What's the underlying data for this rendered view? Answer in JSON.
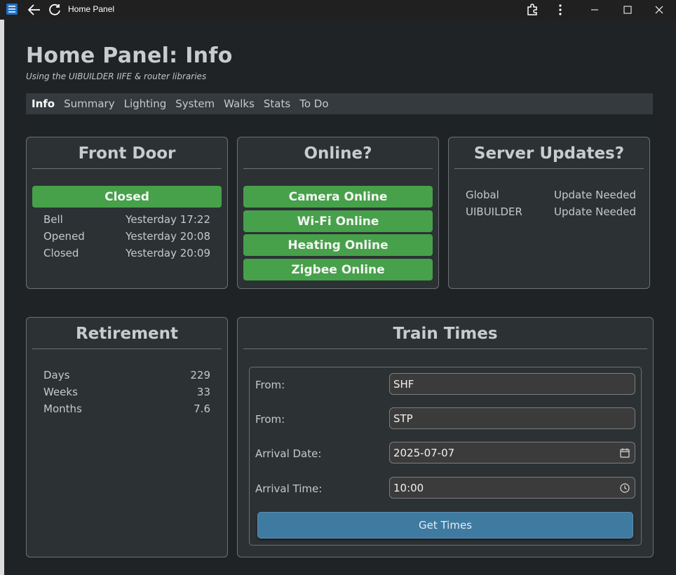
{
  "window": {
    "title": "Home Panel"
  },
  "page": {
    "title": "Home Panel: Info",
    "subtitle": "Using the UIBUILDER IIFE & router libraries"
  },
  "nav": {
    "items": [
      {
        "label": "Info",
        "active": true
      },
      {
        "label": "Summary"
      },
      {
        "label": "Lighting"
      },
      {
        "label": "System"
      },
      {
        "label": "Walks"
      },
      {
        "label": "Stats"
      },
      {
        "label": "To Do"
      }
    ]
  },
  "front_door": {
    "title": "Front Door",
    "status": "Closed",
    "rows": [
      {
        "label": "Bell",
        "value": "Yesterday 17:22"
      },
      {
        "label": "Opened",
        "value": "Yesterday 20:08"
      },
      {
        "label": "Closed",
        "value": "Yesterday 20:09"
      }
    ]
  },
  "online": {
    "title": "Online?",
    "items": [
      "Camera Online",
      "Wi-Fi Online",
      "Heating Online",
      "Zigbee Online"
    ]
  },
  "server_updates": {
    "title": "Server Updates?",
    "rows": [
      {
        "label": "Global",
        "value": "Update Needed"
      },
      {
        "label": "UIBUILDER",
        "value": "Update Needed"
      }
    ]
  },
  "retirement": {
    "title": "Retirement",
    "rows": [
      {
        "label": "Days",
        "value": "229"
      },
      {
        "label": "Weeks",
        "value": "33"
      },
      {
        "label": "Months",
        "value": "7.6"
      }
    ]
  },
  "train_times": {
    "title": "Train Times",
    "from1_label": "From:",
    "from1_value": "SHF",
    "from2_label": "From:",
    "from2_value": "STP",
    "date_label": "Arrival Date:",
    "date_value": "2025-07-07",
    "time_label": "Arrival Time:",
    "time_value": "10:00",
    "button_label": "Get Times"
  },
  "colors": {
    "background": "#1f2326",
    "card": "#2c3134",
    "status_green": "#47a04a",
    "button_blue": "#3f7aa1"
  }
}
